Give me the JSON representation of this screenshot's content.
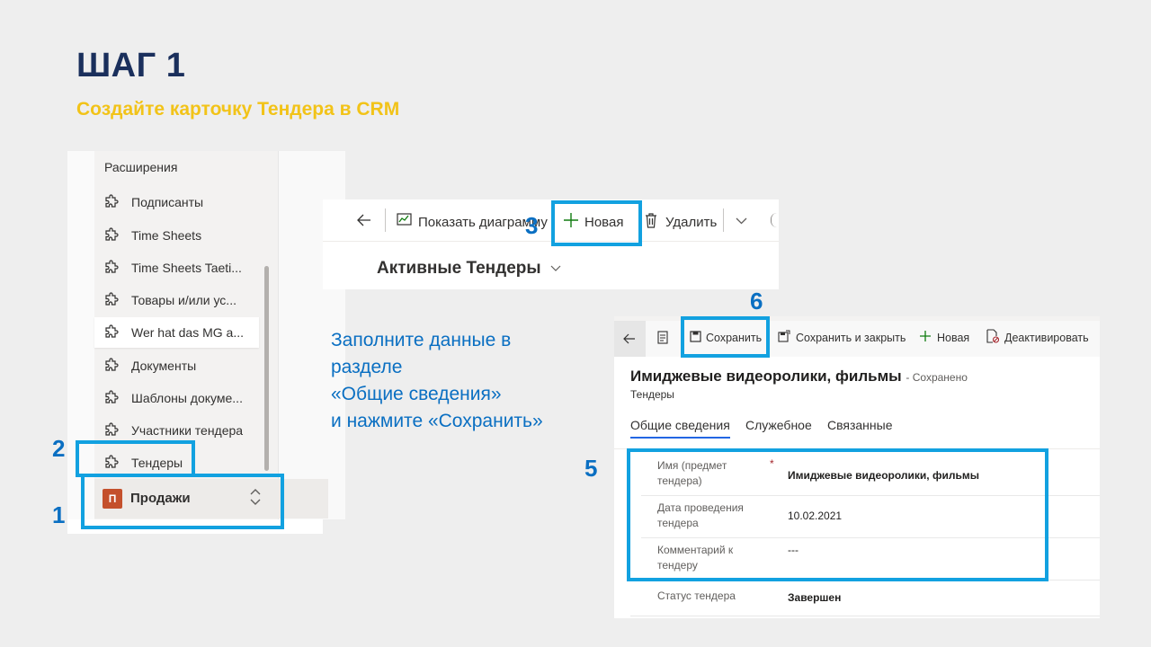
{
  "header": {
    "title": "ШАГ 1",
    "subtitle": "Создайте карточку Тендера в CRM"
  },
  "step_numbers": [
    "1",
    "2",
    "3",
    "5",
    "6"
  ],
  "sitemap": {
    "group_label": "Расширения",
    "items": [
      {
        "label": "Подписанты"
      },
      {
        "label": "Time Sheets"
      },
      {
        "label": "Time Sheets Taeti..."
      },
      {
        "label": "Товары и/или ус..."
      },
      {
        "label": "Wer hat das MG a..."
      },
      {
        "label": "Документы"
      },
      {
        "label": "Шаблоны докуме..."
      },
      {
        "label": "Участники тендера"
      },
      {
        "label": "Тендеры"
      }
    ],
    "area": {
      "avatar": "П",
      "label": "Продажи"
    }
  },
  "list_view": {
    "commands": {
      "show_chart": "Показать диаграмму",
      "new": "Новая",
      "delete": "Удалить"
    },
    "view_name": "Активные Тендеры"
  },
  "instruction": {
    "lines": [
      "Заполните данные в",
      "разделе",
      "«Общие сведения»",
      "и нажмите «Сохранить»"
    ]
  },
  "form": {
    "commands": {
      "save": "Сохранить",
      "save_close": "Сохранить и закрыть",
      "new": "Новая",
      "deactivate": "Деактивировать"
    },
    "record_title": "Имиджевые видеоролики, фильмы",
    "record_status": "- Сохранено",
    "entity": "Тендеры",
    "tabs": [
      "Общие сведения",
      "Служебное",
      "Связанные"
    ],
    "fields": [
      {
        "label": "Имя (предмет тендера)",
        "value": "Имиджевые видеоролики, фильмы",
        "required": true
      },
      {
        "label": "Дата проведения тендера",
        "value": "10.02.2021"
      },
      {
        "label": "Комментарий к тендеру",
        "value": "---"
      },
      {
        "label": "Статус тендера",
        "value": "Завершен"
      }
    ],
    "required_mark": "*"
  },
  "colors": {
    "title": "#1a2f5c",
    "subtitle": "#f2c318",
    "highlight": "#12a1e0",
    "step_number": "#0a6fc2",
    "accent_green": "#107c10"
  }
}
